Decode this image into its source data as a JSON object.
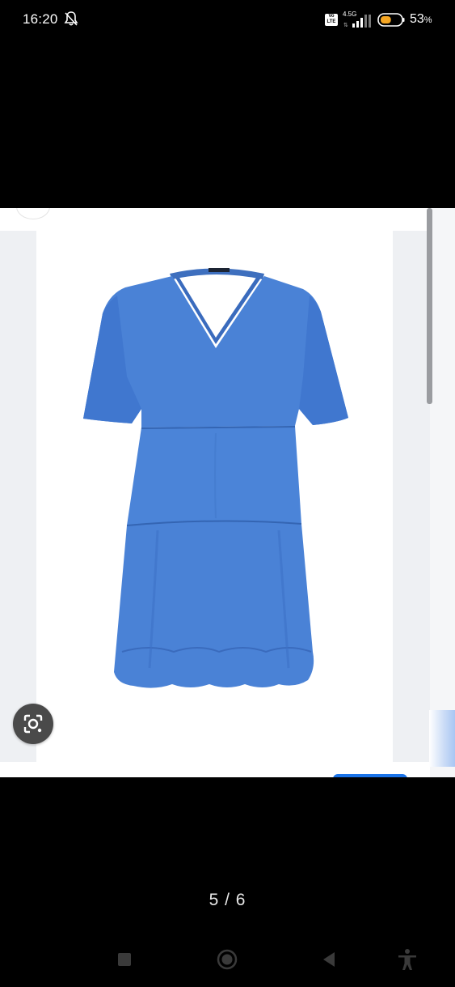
{
  "status_bar": {
    "time": "16:20",
    "network_type": "4.5G",
    "volte_label": "Vo LTE",
    "battery_percent": "53",
    "battery_unit": "%",
    "battery_level": 0.53,
    "battery_color": "#f5a623"
  },
  "viewer": {
    "accent_color": "#1a73e8",
    "product_color": "#4a82d6",
    "lens_icon": "google-lens-icon"
  },
  "pager": {
    "text": "5 / 6"
  },
  "nav_bar": {
    "recent_icon": "square-recents-icon",
    "home_icon": "circle-home-icon",
    "back_icon": "triangle-back-icon",
    "accessibility_icon": "accessibility-person-icon"
  }
}
